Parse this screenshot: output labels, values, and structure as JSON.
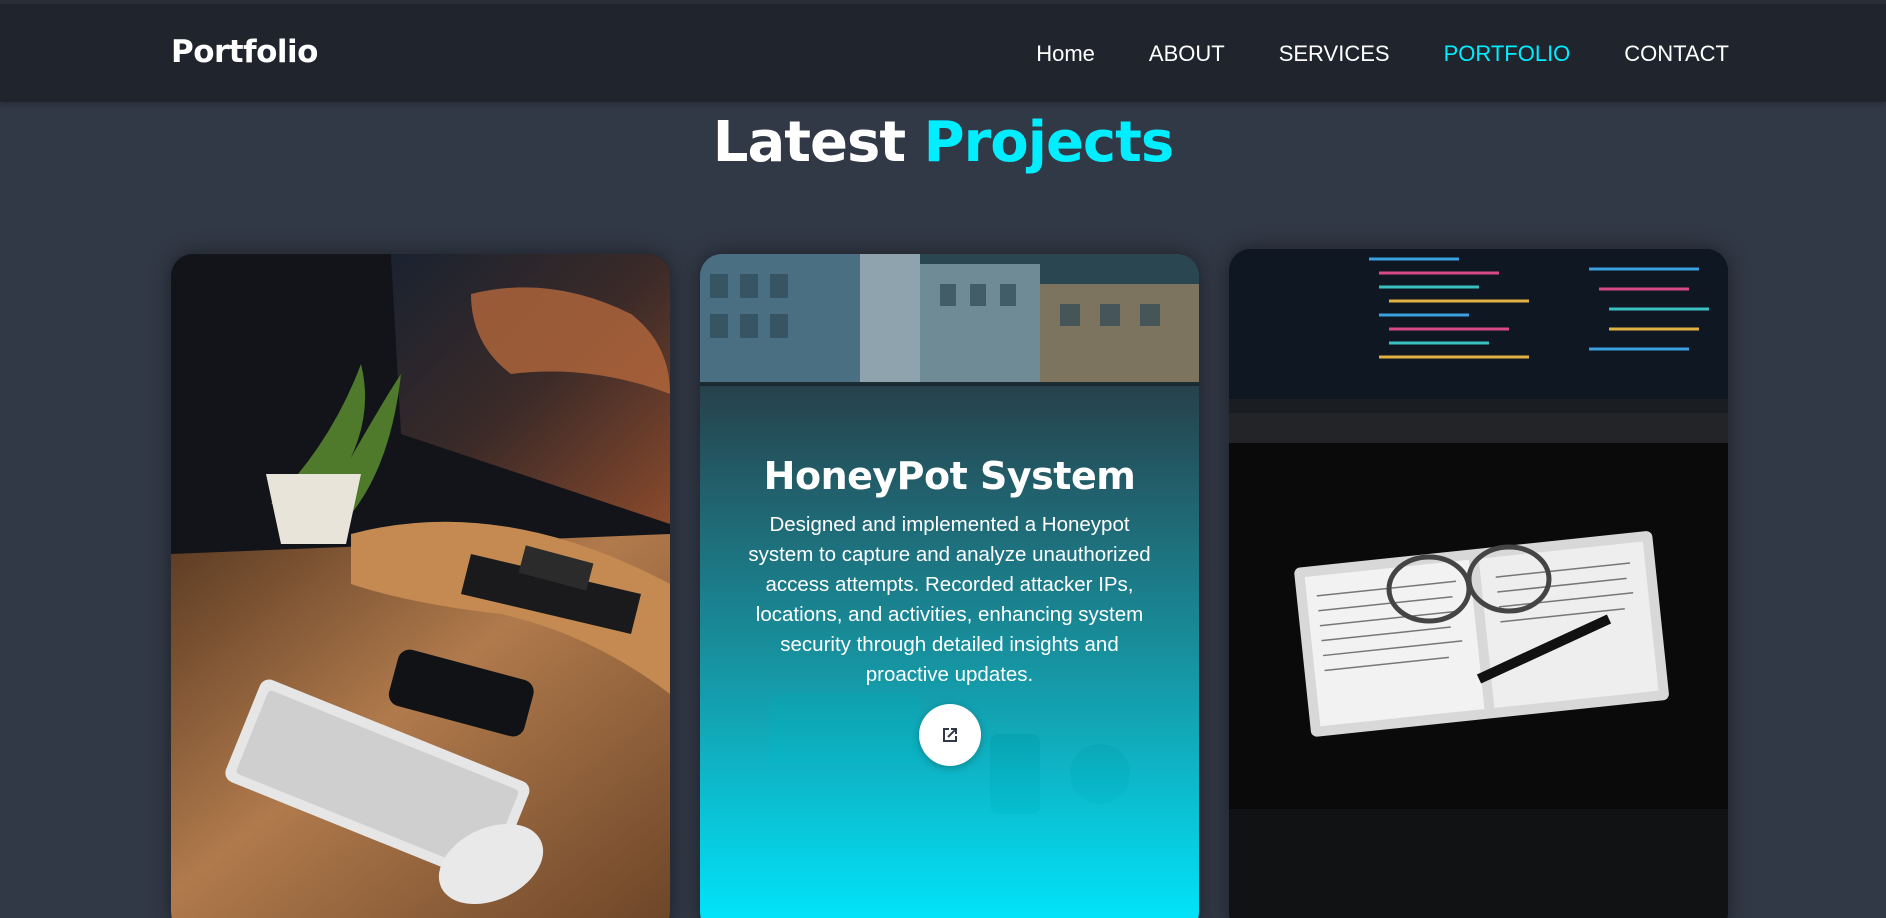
{
  "header": {
    "logo": "Portfolio",
    "nav": [
      {
        "label": "Home",
        "active": false
      },
      {
        "label": "ABOUT",
        "active": false
      },
      {
        "label": "SERVICES",
        "active": false
      },
      {
        "label": "PORTFOLIO",
        "active": true
      },
      {
        "label": "CONTACT",
        "active": false
      }
    ]
  },
  "section": {
    "title_main": "Latest",
    "title_accent": "Projects"
  },
  "projects": [
    {
      "image": "desk-setup-photo"
    },
    {
      "image": "city-laptop-photo",
      "title": "HoneyPot System",
      "description": "Designed and implemented a Honeypot system to capture and analyze unauthorized access attempts. Recorded attacker IPs, locations, and activities, enhancing system security through detailed insights and proactive updates.",
      "link_icon": "external-link-icon"
    },
    {
      "image": "notebook-glasses-photo"
    }
  ],
  "colors": {
    "accent": "#00eeff",
    "background": "#323946",
    "header": "#1f242d"
  }
}
